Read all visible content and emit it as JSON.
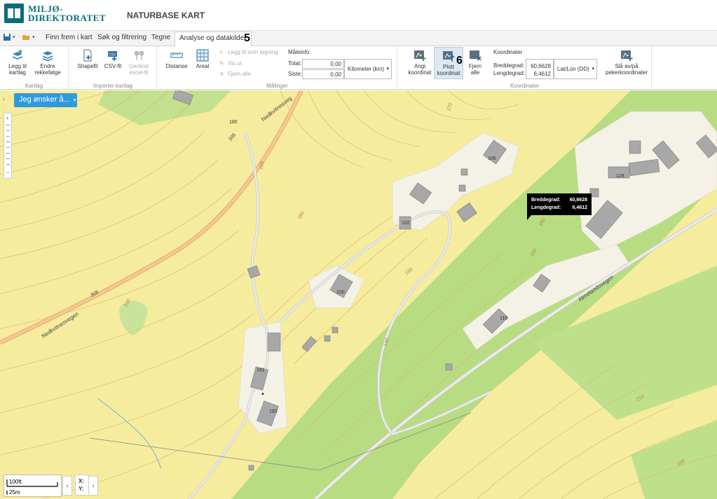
{
  "brand": {
    "logo_line1": "MILJØ-",
    "logo_line2": "DIREKTORATET",
    "app_title": "NATURBASE KART"
  },
  "tabs": [
    "Finn frem i kart",
    "Søk og filtrering",
    "Tegne",
    "Analyse og datakilder"
  ],
  "step_markers": {
    "tab": "5",
    "plot": "6"
  },
  "ribbon": {
    "kartlag": {
      "label": "Kartlag",
      "add": "Legg til kartlag",
      "order": "Endre rekkefølge"
    },
    "importer": {
      "label": "Importer kartlag",
      "shape": "Shapefil",
      "csv": "CSV-fil",
      "geokod": "Geokod excel-fil"
    },
    "malinger": {
      "label": "Målinger",
      "distance": "Distanse",
      "area": "Areal",
      "add_drawing": "Legg til som tegning",
      "show": "Vis ut",
      "remove_all": "Fjern alle",
      "info_label": "Måleinfo:",
      "total_label": "Total:",
      "last_label": "Siste:",
      "total_value": "0,00",
      "last_value": "0,00",
      "unit": "Kilometer (km)"
    },
    "koordinater": {
      "label": "Koordinater",
      "header": "Koordinater",
      "set": "Angi koordinat",
      "plot": "Plott koordinat",
      "remove": "Fjern alle",
      "lat_label": "Breddegrad:",
      "lon_label": "Lengdegrad:",
      "lat_value": "60,6628",
      "lon_value": "6,4612",
      "format": "Lat/Lon (DD)",
      "toggle": "Slå av/på pekerkoordinater"
    }
  },
  "map": {
    "action_button": "Jeg ønsker å...",
    "tooltip": {
      "lat_label": "Breddegrad:",
      "lat": "60,6628",
      "lon_label": "Lengdegrad:",
      "lon": "6,4612"
    },
    "roads": {
      "nedkvitnesvegen_top": "Nedkvitnesveg",
      "nedkvitnesvegen_bottom": "Nedkvitnesvegen",
      "almeland": "Almelandsvegen",
      "road_number": "308"
    },
    "house_numbers": [
      "180",
      "106",
      "128",
      "102",
      "100",
      "116",
      "181",
      "183"
    ],
    "contours": [
      "170",
      "180",
      "160",
      "190",
      "200",
      "150",
      "130",
      "210",
      "220",
      "140"
    ],
    "scale": {
      "feet": "100ft",
      "meters": "25m"
    },
    "xy": {
      "x_label": "X:",
      "y_label": "Y:"
    }
  },
  "colors": {
    "brand": "#0a6d7a",
    "map_bg": "#f6ec9d",
    "forest": "#b8dc82",
    "action_button": "#2f9bdc"
  }
}
